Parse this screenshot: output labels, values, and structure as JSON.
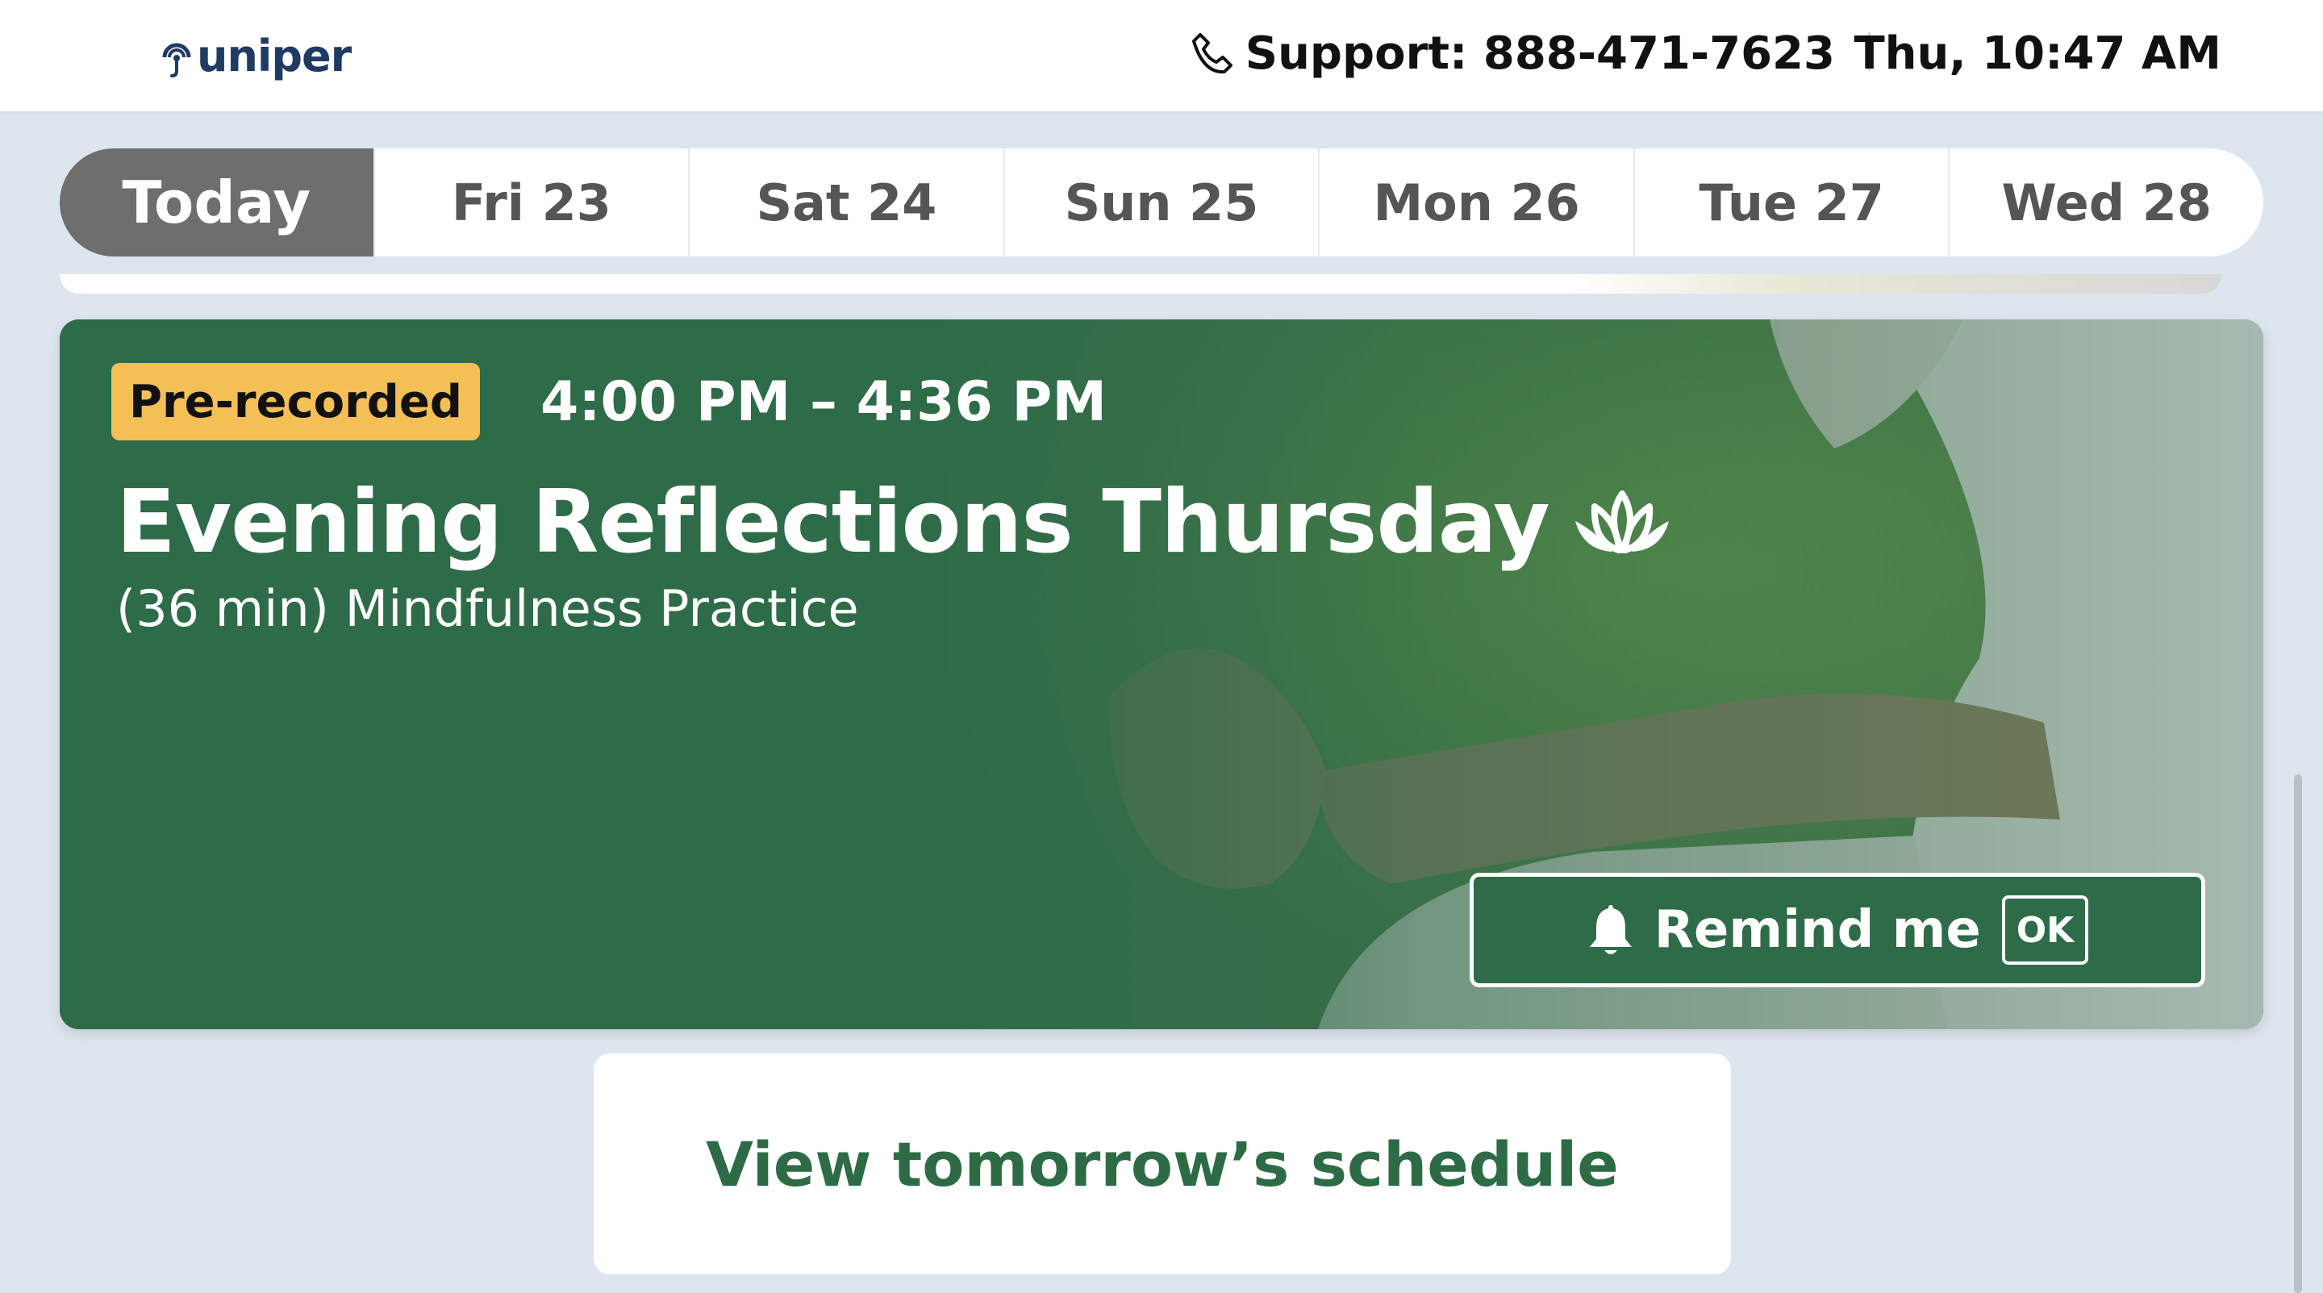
{
  "header": {
    "logo_text": "uniper",
    "support_text": "Support: 888-471-7623",
    "datetime": "Thu, 10:47 AM"
  },
  "tabs": [
    {
      "label": "Today",
      "active": true
    },
    {
      "label": "Fri 23",
      "active": false
    },
    {
      "label": "Sat 24",
      "active": false
    },
    {
      "label": "Sun 25",
      "active": false
    },
    {
      "label": "Mon 26",
      "active": false
    },
    {
      "label": "Tue 27",
      "active": false
    },
    {
      "label": "Wed 28",
      "active": false
    }
  ],
  "session": {
    "badge": "Pre-recorded",
    "time_range": "4:00 PM – 4:36 PM",
    "title": "Evening Reflections Thursday",
    "subtitle": "(36 min) Mindfulness Practice",
    "remind_label": "Remind me",
    "ok_key": "OK"
  },
  "tomorrow_button": "View tomorrow’s schedule",
  "colors": {
    "card_green": "#2e6b48",
    "badge_yellow": "#f4bf55",
    "active_tab": "#6e6e6e",
    "page_bg": "#dde6ee",
    "link_green": "#2d6b45"
  },
  "icons": {
    "logo": "uniper-logo-icon",
    "phone": "phone-icon",
    "lotus": "lotus-icon",
    "bell": "bell-icon"
  }
}
